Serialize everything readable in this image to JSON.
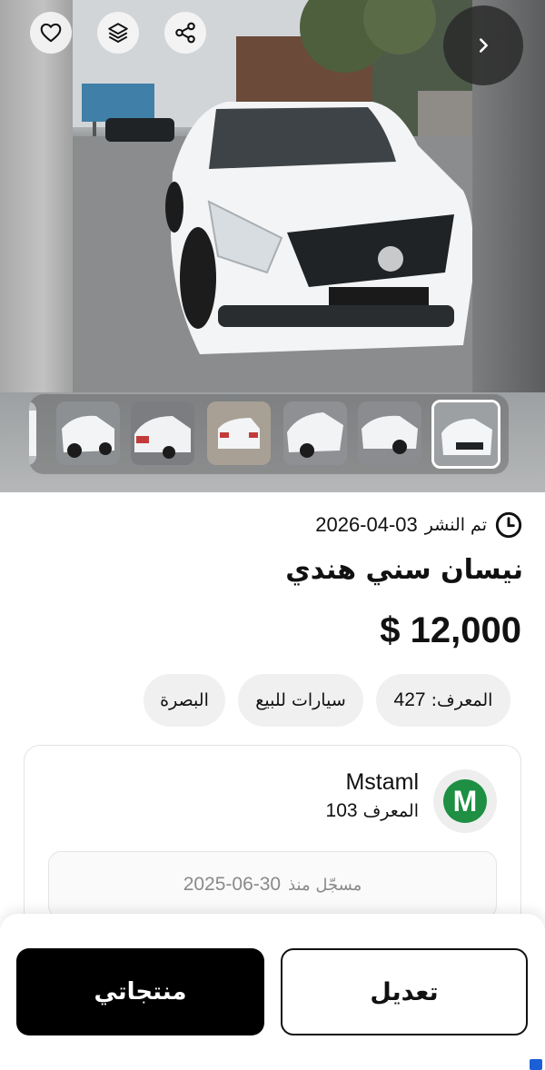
{
  "header": {
    "favorite_icon": "heart-outline-icon",
    "layers_icon": "layers-icon",
    "share_icon": "share-icon",
    "next_icon": "chevron-right-icon",
    "thumbnail_count": 7,
    "active_thumbnail": 7
  },
  "listing": {
    "published_label": "تم النشر",
    "published_date": "2026-04-03",
    "title": "نيسان سني هندي",
    "price": "$ 12,000",
    "chips": {
      "id_label": "المعرف:",
      "id_value": "427",
      "category": "سيارات للبيع",
      "city": "البصرة"
    }
  },
  "seller": {
    "avatar_letter": "M",
    "name": "Mstaml",
    "id_label": "المعرف",
    "id_value": "103",
    "registered_label": "مسجّل منذ",
    "registered_date": "2025-06-30"
  },
  "actions": {
    "my_products": "منتجاتي",
    "edit": "تعديل"
  },
  "colors": {
    "avatar_green": "#1e8f43",
    "primary_button": "#000000"
  }
}
